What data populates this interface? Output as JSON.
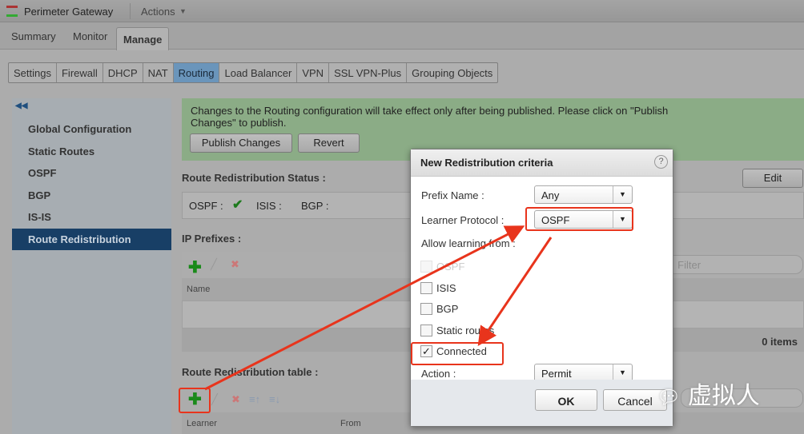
{
  "header": {
    "title": "Perimeter Gateway",
    "actions": "Actions"
  },
  "tabs": [
    "Summary",
    "Monitor",
    "Manage"
  ],
  "subtabs": [
    "Settings",
    "Firewall",
    "DHCP",
    "NAT",
    "Routing",
    "Load Balancer",
    "VPN",
    "SSL VPN-Plus",
    "Grouping Objects"
  ],
  "sidebar": {
    "items": [
      "Global Configuration",
      "Static Routes",
      "OSPF",
      "BGP",
      "IS-IS",
      "Route Redistribution"
    ]
  },
  "banner": {
    "message": "Changes to the Routing configuration will take effect only after being published. Please click on \"Publish Changes\" to publish.",
    "publish": "Publish Changes",
    "revert": "Revert"
  },
  "status": {
    "title": "Route Redistribution Status :",
    "edit": "Edit",
    "ospf": "OSPF :",
    "isis": "ISIS :",
    "bgp": "BGP :"
  },
  "prefixes": {
    "title": "IP Prefixes :",
    "col_name": "Name",
    "filter_placeholder": "Filter",
    "count": "0 items"
  },
  "redist_table": {
    "title": "Route Redistribution table :",
    "col_learner": "Learner",
    "col_from": "From"
  },
  "dialog": {
    "title": "New Redistribution criteria",
    "prefix_label": "Prefix Name :",
    "prefix_value": "Any",
    "learner_label": "Learner Protocol :",
    "learner_value": "OSPF",
    "allow_label": "Allow learning from :",
    "options": [
      {
        "label": "OSPF",
        "checked": false,
        "disabled": true
      },
      {
        "label": "ISIS",
        "checked": false
      },
      {
        "label": "BGP",
        "checked": false
      },
      {
        "label": "Static routes",
        "checked": false
      },
      {
        "label": "Connected",
        "checked": true
      }
    ],
    "action_label": "Action :",
    "action_value": "Permit",
    "ok": "OK",
    "cancel": "Cancel"
  },
  "watermark": "虚拟人",
  "colors": {
    "accent": "#6a95bb",
    "selected": "#183f66",
    "annotation": "#e8341c",
    "banner": "#8bac86"
  }
}
